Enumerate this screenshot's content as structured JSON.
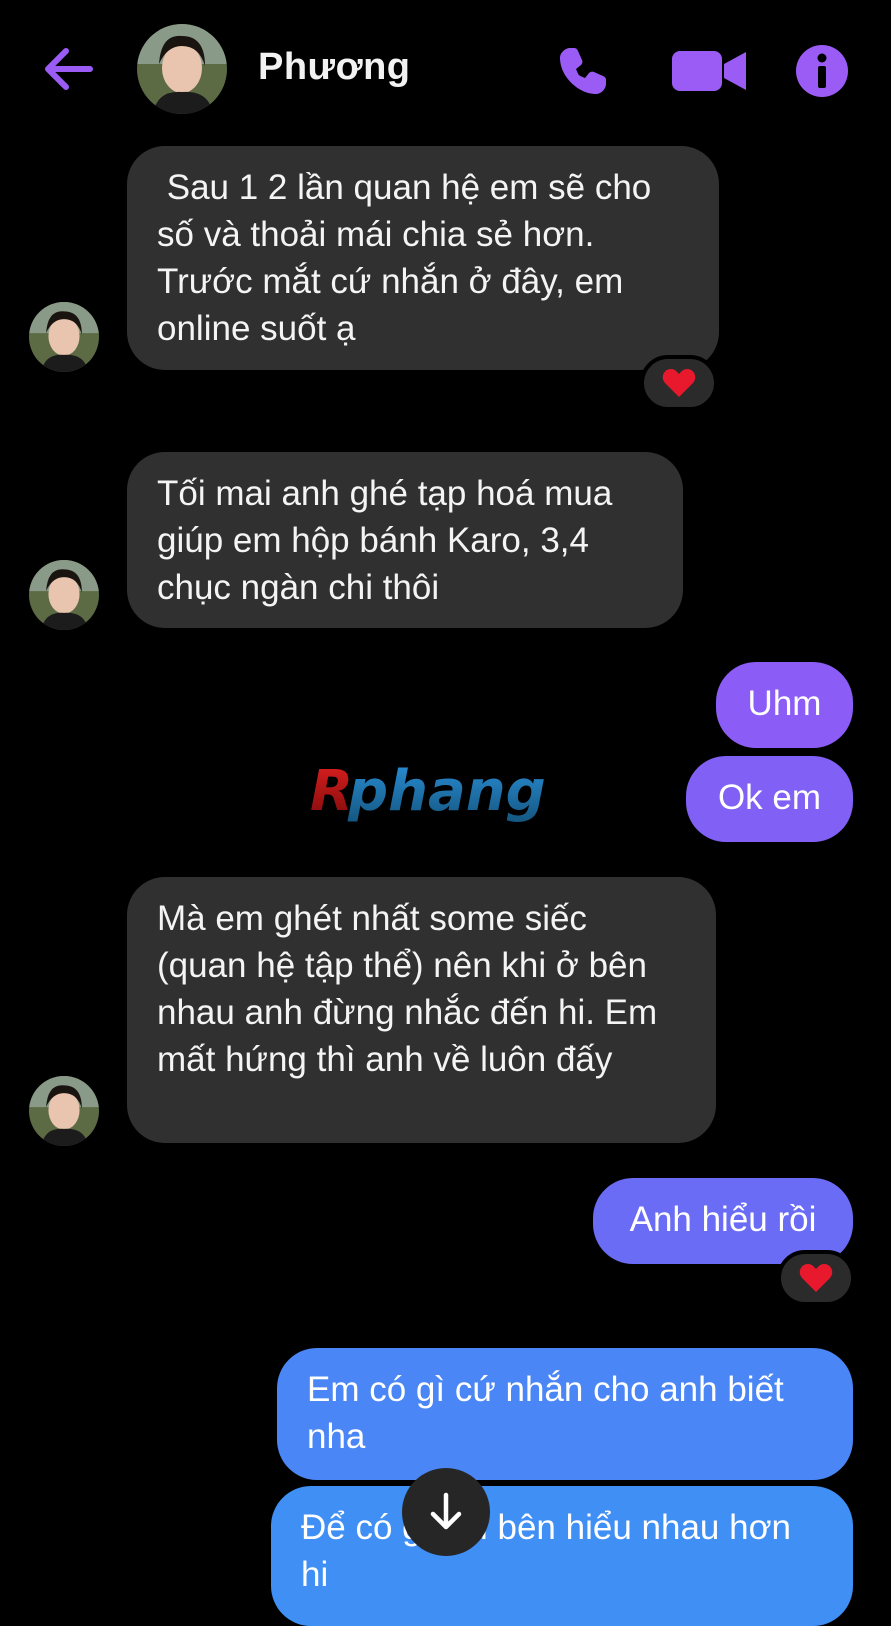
{
  "header": {
    "contact_name": "Phương",
    "back_icon": "arrow-left-icon",
    "call_icon": "phone-icon",
    "video_icon": "video-camera-icon",
    "info_icon": "info-icon"
  },
  "colors": {
    "accent": "#9b5cf5",
    "incoming_bubble": "#303030",
    "outgoing_top": "#8d5cf6",
    "outgoing_bottom": "#3f8ff5",
    "reaction": "#e8192c"
  },
  "messages": [
    {
      "from": "contact",
      "text": " Sau 1 2 lần quan hệ em sẽ cho số và thoải mái chia sẻ hơn. Trước mắt cứ nhắn ở đây, em online suốt ạ",
      "reaction": "heart"
    },
    {
      "from": "contact",
      "text": "Tối mai anh ghé tạp hoá mua giúp em hộp bánh Karo, 3,4 chục ngàn chi thôi"
    },
    {
      "from": "me",
      "text": "Uhm"
    },
    {
      "from": "me",
      "text": "Ok em"
    },
    {
      "from": "contact",
      "text": "Mà em ghét nhất some siếc (quan hệ tập thể) nên khi ở bên nhau anh đừng nhắc đến hi. Em mất hứng thì anh về luôn đấy"
    },
    {
      "from": "me",
      "text": "Anh hiểu rồi",
      "reaction": "heart"
    },
    {
      "from": "me",
      "text": "Em có gì cứ nhắn cho anh biết nha"
    },
    {
      "from": "me",
      "text": "Để có gì hai bên hiểu nhau hơn hi"
    }
  ],
  "watermark": {
    "text": "Rphang"
  },
  "scroll_button": {
    "icon": "arrow-down-icon"
  }
}
